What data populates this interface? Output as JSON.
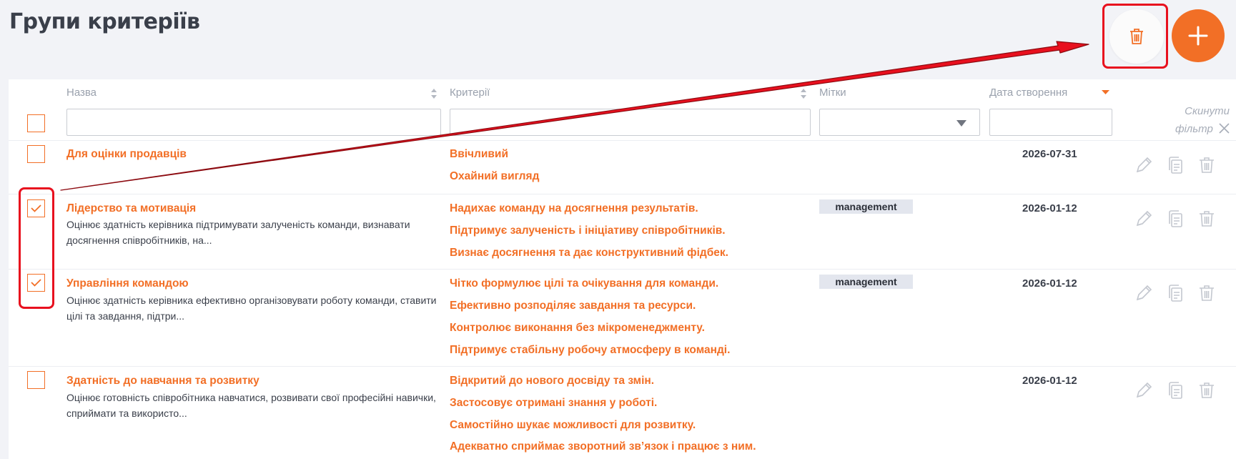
{
  "page": {
    "title": "Групи критеріїв"
  },
  "colors": {
    "accent": "#f26f26",
    "annotation": "#e8101e",
    "text": "#3a3f4a",
    "muted": "#9aa1ad"
  },
  "toolbar": {
    "delete_icon": "trash-icon",
    "add_icon": "plus-icon"
  },
  "table": {
    "columns": {
      "name": "Назва",
      "criteria": "Критерії",
      "tags": "Мітки",
      "created": "Дата створення"
    },
    "reset_filter": "Скинути фільтр",
    "filters": {
      "name_value": "",
      "criteria_value": "",
      "tags_value": "",
      "date_value": ""
    },
    "rows": [
      {
        "title": "Для оцінки продавців",
        "desc": "",
        "criteria": [
          "Ввічливий",
          "Охайний вигляд"
        ],
        "tag": "",
        "date": "2026-07-31",
        "checked": false
      },
      {
        "title": "Лідерство та мотивація",
        "desc": "Оцінює здатність керівника підтримувати залученість команди, визнавати досягнення співробітників, на...",
        "criteria": [
          "Надихає команду на досягнення результатів.",
          "Підтримує залученість і ініціативу співробітників.",
          "Визнає досягнення та дає конструктивний фідбек."
        ],
        "tag": "management",
        "date": "2026-01-12",
        "checked": true
      },
      {
        "title": "Управління командою",
        "desc": "Оцінює здатність керівника ефективно організовувати роботу команди, ставити цілі та завдання, підтри...",
        "criteria": [
          "Чітко формулює цілі та очікування для команди.",
          "Ефективно розподіляє завдання та ресурси.",
          "Контролює виконання без мікроменеджменту.",
          "Підтримує стабільну робочу атмосферу в команді."
        ],
        "tag": "management",
        "date": "2026-01-12",
        "checked": true
      },
      {
        "title": "Здатність до навчання та розвитку",
        "desc": "Оцінює готовність співробітника навчатися, розвивати свої професійні навички, сприймати та використо...",
        "criteria": [
          "Відкритий до нового досвіду та змін.",
          "Застосовує отримані знання у роботі.",
          "Самостійно шукає можливості для розвитку.",
          "Адекватно сприймає зворотний зв’язок і працює з ним."
        ],
        "tag": "",
        "date": "2026-01-12",
        "checked": false
      }
    ]
  }
}
